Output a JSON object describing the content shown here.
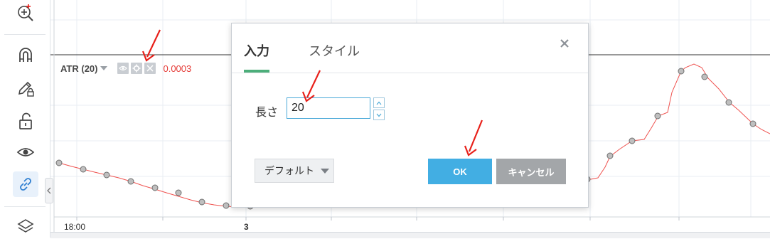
{
  "indicator": {
    "name": "ATR (20)",
    "value": "0.0003"
  },
  "time_axis": {
    "labels": [
      "18:00",
      "3"
    ]
  },
  "dialog": {
    "tabs": [
      {
        "label": "入力",
        "active": true
      },
      {
        "label": "スタイル",
        "active": false
      }
    ],
    "field_label": "長さ",
    "field_value": "20",
    "default_label": "デフォルト",
    "ok_label": "OK",
    "cancel_label": "キャンセル"
  },
  "sidebar": {
    "tools": [
      "zoom-in-icon",
      "magnet-icon",
      "pencil-lock-icon",
      "unlock-icon",
      "eye-icon",
      "link-icon",
      "layers-icon"
    ]
  },
  "colors": {
    "accent_green": "#4cae7a",
    "ok_blue": "#42aee3",
    "cancel_gray": "#a3a6a9",
    "indicator_line": "#ef5350",
    "arrow_red": "#e8201a"
  }
}
